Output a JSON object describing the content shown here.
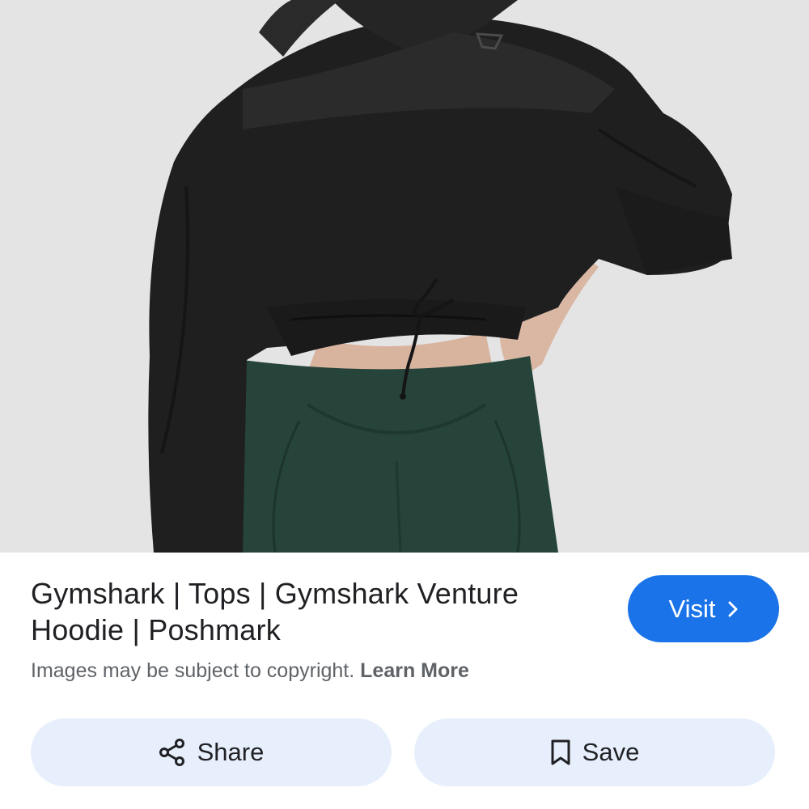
{
  "result": {
    "title_line1": "Gymshark | Tops | Gymshark Venture",
    "title_line2": "Hoodie | Poshmark",
    "visit_label": "Visit",
    "copyright_text": "Images may be subject to copyright.",
    "learn_more_label": "Learn More"
  },
  "actions": {
    "share_label": "Share",
    "save_label": "Save"
  },
  "icons": {
    "visit": "chevron-right-icon",
    "share": "share-icon",
    "save": "bookmark-icon"
  },
  "colors": {
    "accent": "#1a73e8",
    "action_bg": "#e8effc",
    "text_primary": "#202124",
    "text_secondary": "#5f6368"
  }
}
